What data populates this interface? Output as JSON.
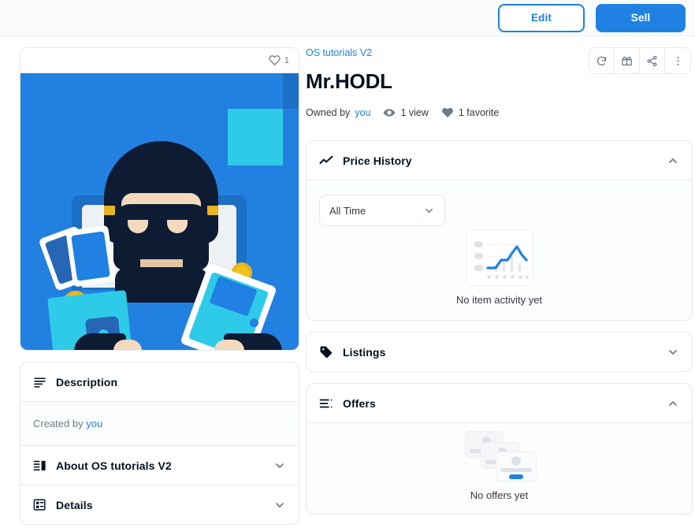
{
  "topbar": {
    "edit_label": "Edit",
    "sell_label": "Sell"
  },
  "artwork": {
    "favorite_count": "1",
    "alt": "Pixel art thief in hood and mask behind laptop holding NFT cards and gold coins",
    "colors": {
      "background_blue": "#2280e0",
      "accent_cyan": "#2ecbe8",
      "dark_navy": "#0d1b33",
      "coin_gold": "#f0c419",
      "skin": "#f3d9bd"
    }
  },
  "item": {
    "collection": "OS tutorials V2",
    "name": "Mr.HODL",
    "owner_prefix": "Owned by",
    "owner": "you",
    "views": "1 view",
    "favorites": "1 favorite"
  },
  "item_actions": [
    {
      "name": "refresh-metadata",
      "icon": "refresh-icon"
    },
    {
      "name": "gift-item",
      "icon": "gift-icon"
    },
    {
      "name": "share-item",
      "icon": "share-icon"
    },
    {
      "name": "more-options",
      "icon": "more-vertical-icon"
    }
  ],
  "price_history": {
    "title": "Price History",
    "icon": "line-chart-icon",
    "expanded": true,
    "chevron": "chevron-up-icon",
    "range_selected": "All Time",
    "range_chevron": "chevron-down-icon",
    "empty_text": "No item activity yet"
  },
  "listings": {
    "title": "Listings",
    "icon": "tag-icon",
    "expanded": false,
    "chevron": "chevron-down-icon"
  },
  "offers": {
    "title": "Offers",
    "icon": "list-icon",
    "expanded": true,
    "chevron": "chevron-up-icon",
    "empty_text": "No offers yet"
  },
  "description": {
    "title": "Description",
    "icon": "description-icon",
    "created_prefix": "Created by",
    "created_by": "you"
  },
  "about": {
    "title": "About OS tutorials V2",
    "icon": "about-collection-icon",
    "chevron": "chevron-down-icon"
  },
  "details": {
    "title": "Details",
    "icon": "details-grid-icon",
    "chevron": "chevron-down-icon"
  },
  "chart_data": {
    "type": "line",
    "title": "Price History",
    "x": [],
    "values": [],
    "series": [],
    "xlabel": "",
    "ylabel": "",
    "legend": [],
    "grid": true,
    "range": "All Time",
    "empty": true,
    "empty_message": "No item activity yet"
  }
}
